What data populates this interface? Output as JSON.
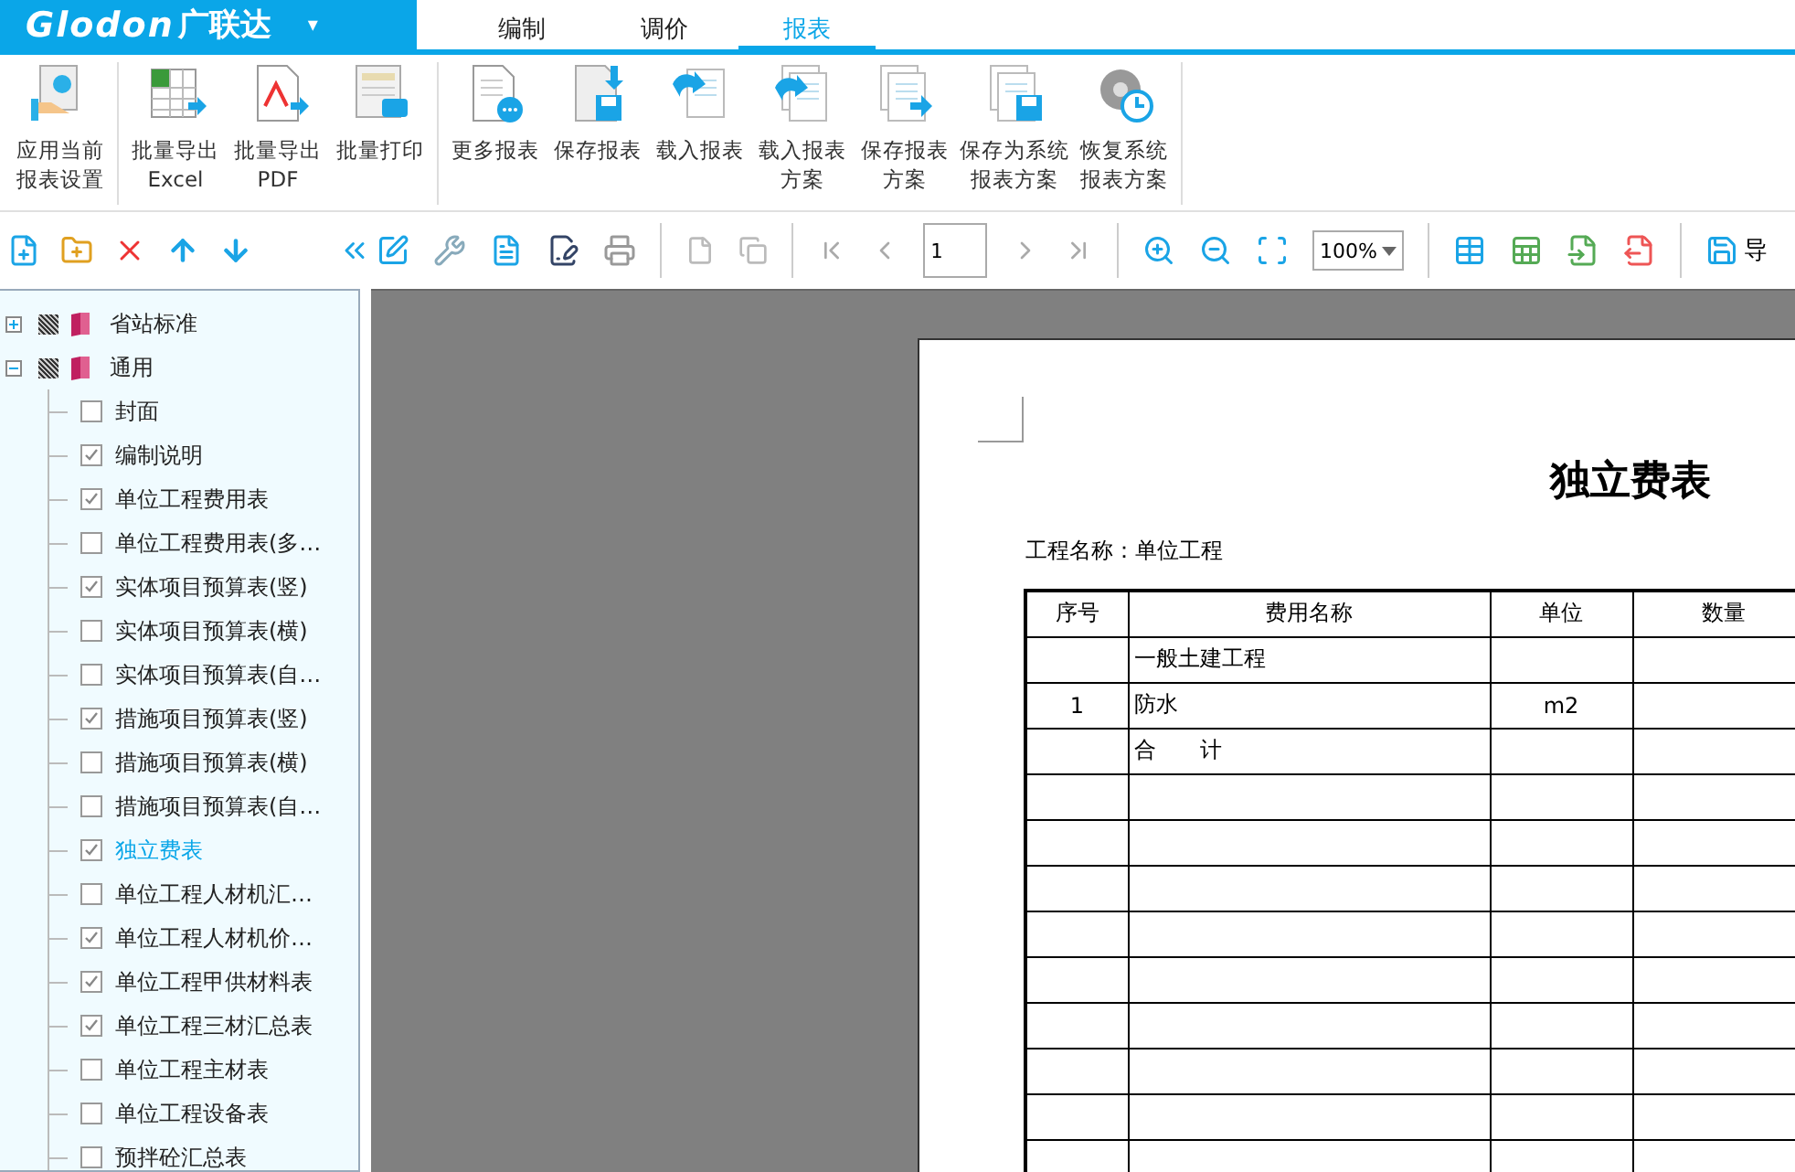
{
  "logo": {
    "text": "Glodon",
    "suffix": "广联达",
    "menu_caret": "▾"
  },
  "tabs": [
    {
      "label": "编制",
      "selected": false
    },
    {
      "label": "调价",
      "selected": false
    },
    {
      "label": "报表",
      "selected": true
    }
  ],
  "ribbon": {
    "groups": [
      {
        "buttons": [
          [
            "应用当前",
            "报表设置"
          ]
        ]
      },
      {
        "buttons": [
          [
            "批量导出",
            "Excel"
          ],
          [
            "批量导出",
            "PDF"
          ],
          [
            "批量打印"
          ]
        ]
      },
      {
        "buttons": [
          [
            "更多报表"
          ],
          [
            "保存报表"
          ],
          [
            "载入报表"
          ],
          [
            "载入报表",
            "方案"
          ],
          [
            "保存报表",
            "方案"
          ],
          [
            "保存为系统",
            "报表方案"
          ],
          [
            "恢复系统",
            "报表方案"
          ]
        ]
      }
    ]
  },
  "toolbar": {
    "page": "1",
    "zoom": "100%",
    "export_label": "导"
  },
  "tree": [
    {
      "label": "省站标准",
      "expanded": false
    },
    {
      "label": "通用",
      "expanded": true,
      "children": [
        {
          "label": "封面",
          "checked": false,
          "selected": false
        },
        {
          "label": "编制说明",
          "checked": true,
          "selected": false
        },
        {
          "label": "单位工程费用表",
          "checked": true,
          "selected": false
        },
        {
          "label": "单位工程费用表(多…",
          "checked": false,
          "selected": false
        },
        {
          "label": "实体项目预算表(竖)",
          "checked": true,
          "selected": false
        },
        {
          "label": "实体项目预算表(横)",
          "checked": false,
          "selected": false
        },
        {
          "label": "实体项目预算表(自…",
          "checked": false,
          "selected": false
        },
        {
          "label": "措施项目预算表(竖)",
          "checked": true,
          "selected": false
        },
        {
          "label": "措施项目预算表(横)",
          "checked": false,
          "selected": false
        },
        {
          "label": "措施项目预算表(自…",
          "checked": false,
          "selected": false
        },
        {
          "label": "独立费表",
          "checked": true,
          "selected": true
        },
        {
          "label": "单位工程人材机汇…",
          "checked": false,
          "selected": false
        },
        {
          "label": "单位工程人材机价…",
          "checked": true,
          "selected": false
        },
        {
          "label": "单位工程甲供材料表",
          "checked": true,
          "selected": false
        },
        {
          "label": "单位工程三材汇总表",
          "checked": true,
          "selected": false
        },
        {
          "label": "单位工程主材表",
          "checked": false,
          "selected": false
        },
        {
          "label": "单位工程设备表",
          "checked": false,
          "selected": false
        },
        {
          "label": "预拌砼汇总表",
          "checked": false,
          "selected": false
        }
      ]
    }
  ],
  "report": {
    "title": "独立费表",
    "project": "工程名称：单位工程",
    "columns": [
      "序号",
      "费用名称",
      "单位",
      "数量"
    ],
    "rows": [
      [
        "",
        "一般土建工程",
        "",
        ""
      ],
      [
        "1",
        "防水",
        "m2",
        ""
      ],
      [
        "",
        "合　　计",
        "",
        ""
      ]
    ]
  }
}
